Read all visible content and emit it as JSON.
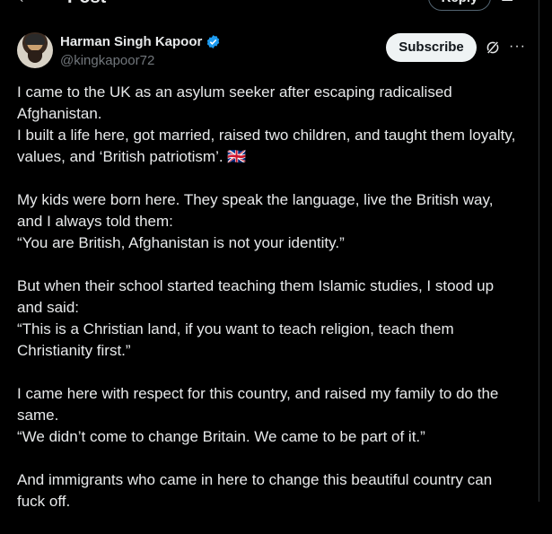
{
  "header": {
    "title": "Post",
    "reply_label": "Reply",
    "back_icon": "arrow-left-icon",
    "composer_icon": "compose-icon"
  },
  "post": {
    "author_name": "Harman Singh Kapoor",
    "handle": "@kingkapoor72",
    "verified_color": "#1d9bf0",
    "subscribe_label": "Subscribe",
    "paragraphs": [
      [
        "I came to the UK as an asylum seeker after escaping radicalised Afghanistan.",
        "I built a life here, got married, raised two children, and taught them loyalty, values, and ‘British patriotism’. 🇬🇧"
      ],
      [
        "My kids were born here. They speak the language, live the British way, and I always told them:",
        "“You are British, Afghanistan is not your identity.”"
      ],
      [
        "But when their school started teaching them Islamic studies, I stood up and said:",
        "“This is a Christian land, if you want to teach religion, teach them Christianity first.”"
      ],
      [
        "I came here with respect for this country, and raised my family to do the same.",
        "“We didn’t come to change Britain. We came to be part of it.”"
      ],
      [
        "And immigrants who came in here to change this beautiful country can fuck off."
      ]
    ]
  },
  "colors": {
    "background": "#000000",
    "text": "#e7e9ea",
    "muted": "#71767b",
    "divider": "#2f3336"
  }
}
